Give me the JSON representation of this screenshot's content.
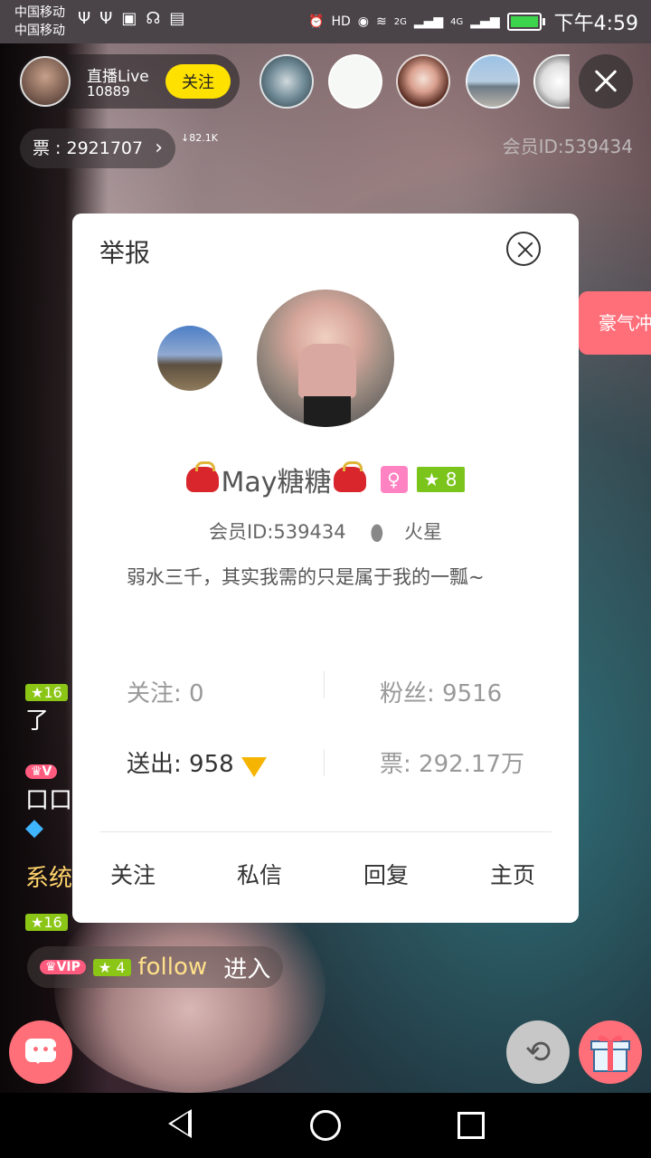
{
  "status_bar": {
    "carrier_1": "中国移动",
    "carrier_2": "中国移动",
    "network_1": "2G",
    "network_2": "4G",
    "time": "下午4:59"
  },
  "host": {
    "name": "直播Live",
    "count": "10889",
    "follow_label": "关注"
  },
  "ticket": {
    "label": "票 : 2921707",
    "speed": "↓82.1K"
  },
  "member_id_top": "会员ID:539434",
  "side_tag": "豪气冲",
  "chat": {
    "lines": [
      {
        "level": "16",
        "text": "了"
      },
      {
        "text": "口口"
      },
      {
        "system": "系统"
      },
      {
        "level": "16"
      }
    ],
    "enter": {
      "vip": "VIP",
      "level": "4",
      "user": "follow",
      "action": "进入"
    }
  },
  "dialog": {
    "title": "举报",
    "username": "May糖糖",
    "level": "8",
    "member_id": "会员ID:539434",
    "location": "火星",
    "bio": "弱水三千，其实我需的只是属于我的一瓢~",
    "stats": {
      "following": "关注: 0",
      "fans": "粉丝: 9516",
      "sent": "送出: 958",
      "tickets": "票: 292.17万"
    },
    "actions": {
      "follow": "关注",
      "message": "私信",
      "reply": "回复",
      "homepage": "主页"
    }
  },
  "colors": {
    "follow_button": "#ffe100",
    "accent_pink": "#ff6f79",
    "level_green": "#7ac41b"
  }
}
